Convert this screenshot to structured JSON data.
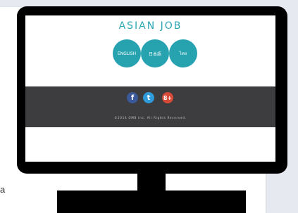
{
  "page": {
    "fragment_text": "a"
  },
  "site": {
    "title": "ASIAN JOB",
    "language_buttons": [
      "ENGLISH",
      "日本語",
      "ไทย"
    ],
    "social": {
      "facebook": "f",
      "twitter": "t",
      "googleplus": "8+"
    },
    "copyright": "©2014 GMB Inc. All Rights Reserved."
  },
  "colors": {
    "accent": "#27a3b0",
    "footer": "#3d3d3f",
    "facebook": "#3b5998",
    "twitter": "#2e9ad9",
    "googleplus": "#d84a38"
  }
}
